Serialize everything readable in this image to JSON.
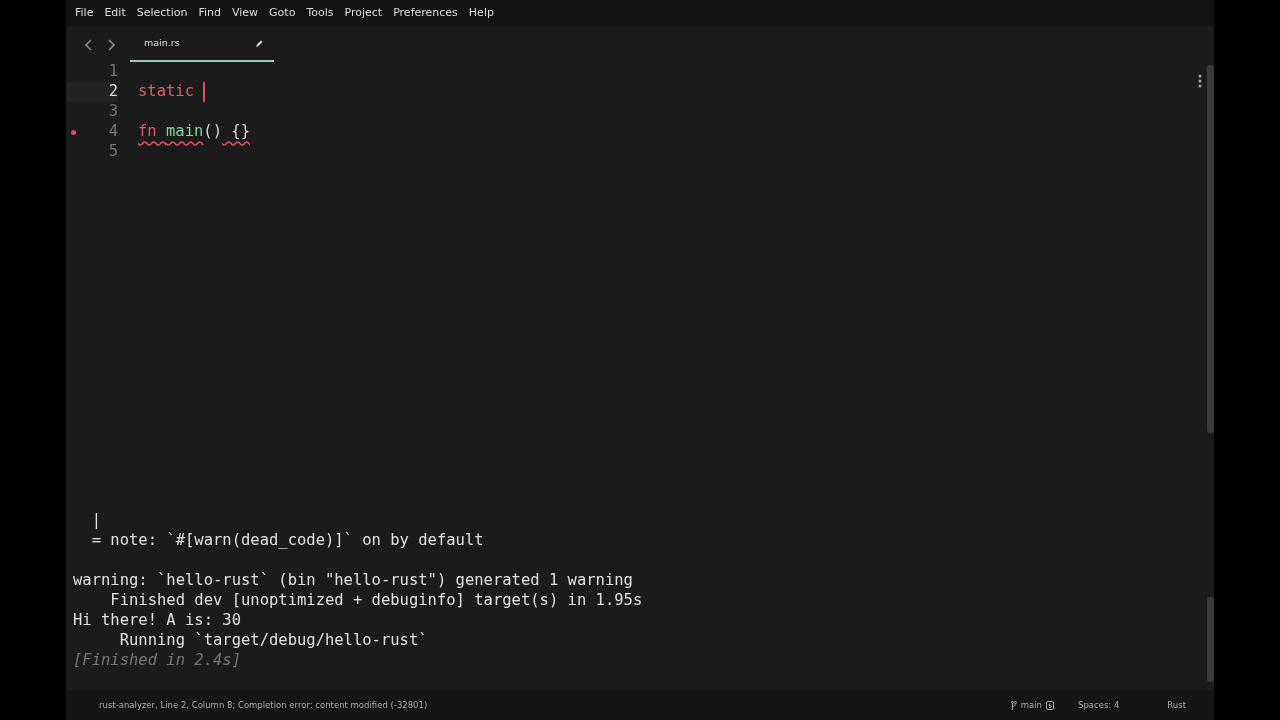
{
  "menu": [
    "File",
    "Edit",
    "Selection",
    "Find",
    "View",
    "Goto",
    "Tools",
    "Project",
    "Preferences",
    "Help"
  ],
  "tabs": [
    {
      "title": "main.rs",
      "selected": true,
      "modified": true
    }
  ],
  "editor": {
    "lines": [
      {
        "number": "1",
        "current": false,
        "error": false
      },
      {
        "number": "2",
        "current": true,
        "error": false,
        "tokens": [
          {
            "text": "static ",
            "kind": "keyword",
            "underline": false
          }
        ]
      },
      {
        "number": "3",
        "current": false,
        "error": false
      },
      {
        "number": "4",
        "current": false,
        "error": true,
        "tokens": [
          {
            "text": "fn ",
            "kind": "keyword",
            "underline": true
          },
          {
            "text": "main",
            "kind": "function",
            "underline": true
          },
          {
            "text": "()",
            "kind": "punct",
            "underline": false
          },
          {
            "text": " {}",
            "kind": "punct",
            "underline": true
          }
        ]
      },
      {
        "number": "5",
        "current": false,
        "error": false
      }
    ]
  },
  "output": {
    "lines": [
      {
        "text": "  |",
        "kind": "normal"
      },
      {
        "text": "  = note: `#[warn(dead_code)]` on by default",
        "kind": "normal"
      },
      {
        "kind": "blank"
      },
      {
        "text": "warning: `hello-rust` (bin \"hello-rust\") generated 1 warning",
        "kind": "normal"
      },
      {
        "text": "    Finished dev [unoptimized + debuginfo] target(s) in 1.95s",
        "kind": "normal"
      },
      {
        "text": "Hi there! A is: 30",
        "kind": "normal"
      },
      {
        "text": "     Running `target/debug/hello-rust`",
        "kind": "normal"
      },
      {
        "text": "[Finished in 2.4s]",
        "kind": "dim"
      }
    ]
  },
  "status_bar": {
    "message": "rust-analyzer, Line 2, Column 8; Completion error: content modified (-32801)",
    "branch": "main",
    "indentation": "Spaces: 4",
    "syntax": "Rust"
  }
}
